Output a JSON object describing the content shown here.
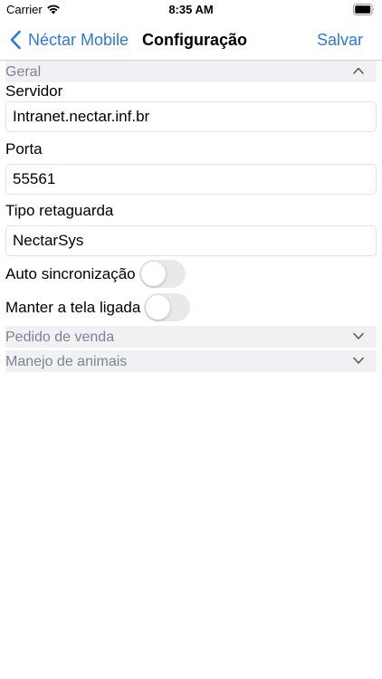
{
  "status_bar": {
    "carrier": "Carrier",
    "time": "8:35 AM"
  },
  "nav": {
    "back_label": "Néctar Mobile",
    "title": "Configuração",
    "save_label": "Salvar"
  },
  "sections": {
    "geral": {
      "label": "Geral",
      "expanded": true,
      "servidor": {
        "label": "Servidor",
        "value": "Intranet.nectar.inf.br"
      },
      "porta": {
        "label": "Porta",
        "value": "55561"
      },
      "tipo_retaguarda": {
        "label": "Tipo retaguarda",
        "value": "NectarSys"
      },
      "auto_sync": {
        "label": "Auto sincronização",
        "on": false
      },
      "keep_screen_on": {
        "label": "Manter a tela ligada",
        "on": false
      }
    },
    "pedido_venda": {
      "label": "Pedido de venda",
      "expanded": false
    },
    "manejo_animais": {
      "label": "Manejo de animais",
      "expanded": false
    }
  },
  "colors": {
    "accent": "#2a7ae2",
    "section_bg": "#f1f1f3",
    "section_text": "#7b8493",
    "toggle_off": "#e9e9eb"
  },
  "icons": {
    "wifi": "wifi-icon",
    "battery": "battery-icon",
    "back": "chevron-left-icon",
    "collapse": "chevron-up-icon",
    "expand": "chevron-down-icon"
  }
}
